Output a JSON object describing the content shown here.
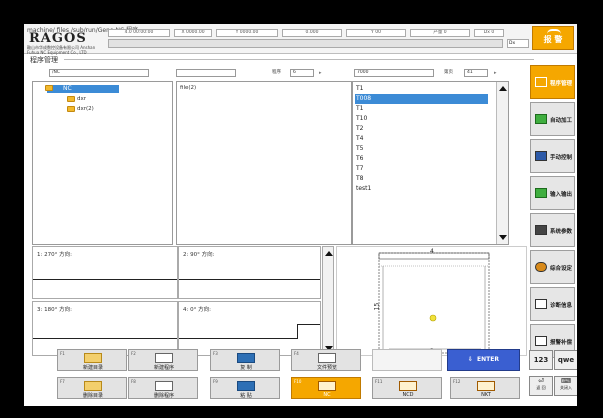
{
  "header": {
    "path_text": "machine/ files /sub/run/Gene NC 程序",
    "logo": "RAGOS",
    "logo_sub": "鞍山市华成数控设备有限公司 Anshan Fuhua NC Equipment Co., LTD",
    "status_fields": [
      "4.0 00:00:00",
      "X 0000.00",
      "Y 0000.00",
      "0.000",
      "Y 00",
      "产量 0",
      "Dx 0"
    ],
    "status_small": "Dx",
    "alarm_label": "报 警"
  },
  "section_title": "程序管理",
  "file_manager": {
    "tree_path": "/NC",
    "file_path": "",
    "count_label": "程序",
    "count_value": "6",
    "tool_path": "7000",
    "page_label": "第页",
    "page_value": "41",
    "tree": {
      "root": "NC",
      "children": [
        "dxr",
        "dxr(2)"
      ]
    },
    "files": [
      "file(2)"
    ],
    "tools": [
      "T1",
      "T008",
      "T1",
      "T10",
      "T2",
      "T4",
      "T5",
      "T6",
      "T7",
      "T8",
      "test1"
    ],
    "selected_tool_index": 1
  },
  "graphs": [
    {
      "label": "1: 270° 方向:"
    },
    {
      "label": "2: 90° 方向:"
    },
    {
      "label": "3: 180° 方向:"
    },
    {
      "label": "4: 0° 方向:"
    }
  ],
  "preview": {
    "top_label": "4",
    "side_label": "15",
    "bottom_label": "3"
  },
  "right_buttons": [
    {
      "label": "程序管理",
      "icon": "floppy-disk-icon",
      "active": true
    },
    {
      "label": "自动加工",
      "icon": "hand-tool-icon",
      "active": false
    },
    {
      "label": "手动控制",
      "icon": "manual-control-icon",
      "active": false
    },
    {
      "label": "输入输出",
      "icon": "io-board-icon",
      "active": false
    },
    {
      "label": "系统参数",
      "icon": "system-params-icon",
      "active": false
    },
    {
      "label": "综合设定",
      "icon": "gear-icon",
      "active": false
    },
    {
      "label": "诊断信息",
      "icon": "diagnosis-icon",
      "active": false
    },
    {
      "label": "报警补偿",
      "icon": "alarm-comp-icon",
      "active": false
    }
  ],
  "fkeys_row1": [
    {
      "key": "F1",
      "label": "新建目录",
      "icon": "folder-icon"
    },
    {
      "key": "F2",
      "label": "新建程序",
      "icon": "new-program-icon"
    },
    {
      "key": "F3",
      "label": "复 制",
      "icon": "copy-icon"
    },
    {
      "key": "F4",
      "label": "文件预览",
      "icon": "preview-icon"
    }
  ],
  "fkeys_row2": [
    {
      "key": "F7",
      "label": "删除目录",
      "icon": "delete-folder-icon"
    },
    {
      "key": "F8",
      "label": "删除程序",
      "icon": "delete-program-icon"
    },
    {
      "key": "F9",
      "label": "粘 贴",
      "icon": "paste-icon"
    },
    {
      "key": "F10",
      "label": "NC",
      "icon": "nc-icon",
      "active": true
    },
    {
      "key": "F11",
      "label": "NCD",
      "icon": "ncd-icon"
    },
    {
      "key": "F12",
      "label": "NKT",
      "icon": "nkt-icon"
    }
  ],
  "enter_label": "ENTER",
  "small_keys": {
    "num_label": "123",
    "alpha_label": "qwe",
    "back_label": "返 回",
    "lock_label": "关闭入"
  }
}
